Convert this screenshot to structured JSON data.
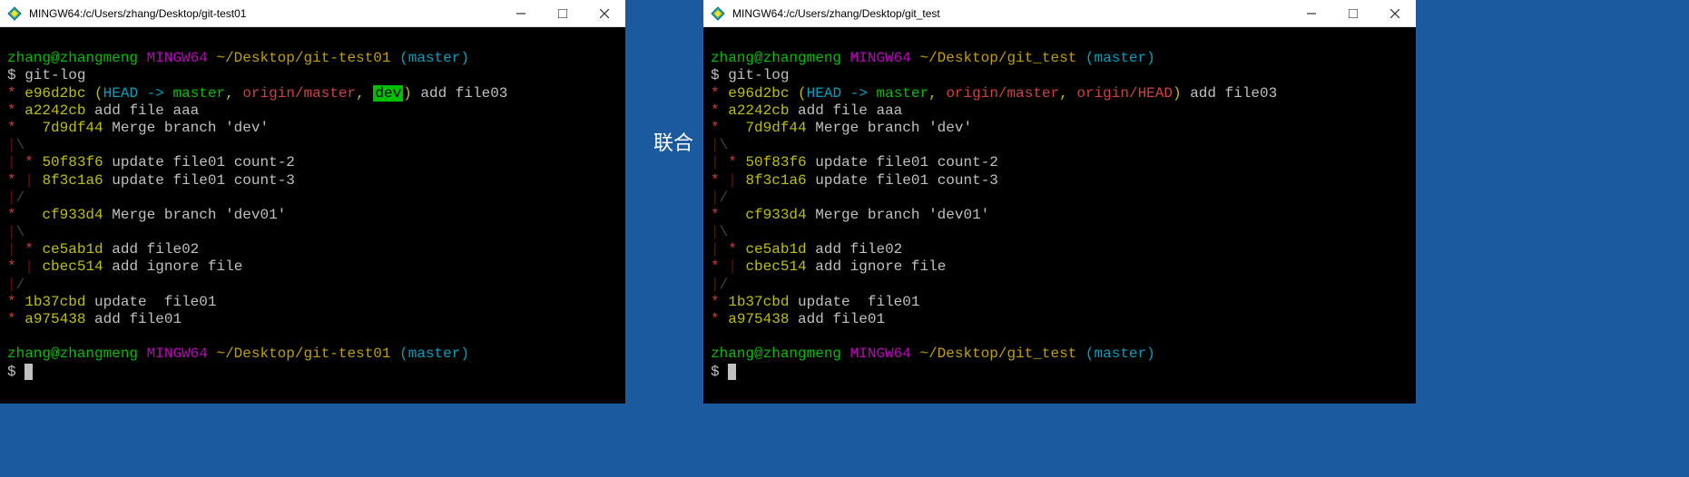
{
  "joint_label": "联合",
  "left": {
    "title": "MINGW64:/c/Users/zhang/Desktop/git-test01",
    "user": "zhang@zhangmeng",
    "shell": "MINGW64",
    "path": "~/Desktop/git-test01",
    "branch": "(master)",
    "cmd": "$ git-log",
    "refs": {
      "head": "HEAD",
      "arrow": "->",
      "master": "master",
      "origin": "origin/master",
      "dev": "dev",
      "msg": "add file03",
      "hash": "e96d2bc"
    },
    "lines": [
      {
        "graph": "* ",
        "hash": "a2242cb",
        "msg": "add file aaa"
      },
      {
        "graph": "*   ",
        "hash": "7d9df44",
        "msg": "Merge branch 'dev'"
      },
      {
        "graph": "|\\  "
      },
      {
        "graph": "| * ",
        "hash": "50f83f6",
        "msg": "update file01 count-2"
      },
      {
        "graph": "* | ",
        "hash": "8f3c1a6",
        "msg": "update file01 count-3"
      },
      {
        "graph": "|/  "
      },
      {
        "graph": "*   ",
        "hash": "cf933d4",
        "msg": "Merge branch 'dev01'"
      },
      {
        "graph": "|\\  "
      },
      {
        "graph": "| * ",
        "hash": "ce5ab1d",
        "msg": "add file02"
      },
      {
        "graph": "* | ",
        "hash": "cbec514",
        "msg": "add ignore file"
      },
      {
        "graph": "|/  "
      },
      {
        "graph": "* ",
        "hash": "1b37cbd",
        "msg": "update  file01"
      },
      {
        "graph": "* ",
        "hash": "a975438",
        "msg": "add file01"
      }
    ],
    "prompt2": "$ "
  },
  "right": {
    "title": "MINGW64:/c/Users/zhang/Desktop/git_test",
    "user": "zhang@zhangmeng",
    "shell": "MINGW64",
    "path": "~/Desktop/git_test",
    "branch": "(master)",
    "cmd": "$ git-log",
    "refs": {
      "head": "HEAD",
      "arrow": "->",
      "master": "master",
      "origin": "origin/master",
      "ohead": "origin/HEAD",
      "msg": "add file03",
      "hash": "e96d2bc"
    },
    "lines": [
      {
        "graph": "* ",
        "hash": "a2242cb",
        "msg": "add file aaa"
      },
      {
        "graph": "*   ",
        "hash": "7d9df44",
        "msg": "Merge branch 'dev'"
      },
      {
        "graph": "|\\  "
      },
      {
        "graph": "| * ",
        "hash": "50f83f6",
        "msg": "update file01 count-2"
      },
      {
        "graph": "* | ",
        "hash": "8f3c1a6",
        "msg": "update file01 count-3"
      },
      {
        "graph": "|/  "
      },
      {
        "graph": "*   ",
        "hash": "cf933d4",
        "msg": "Merge branch 'dev01'"
      },
      {
        "graph": "|\\  "
      },
      {
        "graph": "| * ",
        "hash": "ce5ab1d",
        "msg": "add file02"
      },
      {
        "graph": "* | ",
        "hash": "cbec514",
        "msg": "add ignore file"
      },
      {
        "graph": "|/  "
      },
      {
        "graph": "* ",
        "hash": "1b37cbd",
        "msg": "update  file01"
      },
      {
        "graph": "* ",
        "hash": "a975438",
        "msg": "add file01"
      }
    ],
    "prompt2": "$ "
  }
}
